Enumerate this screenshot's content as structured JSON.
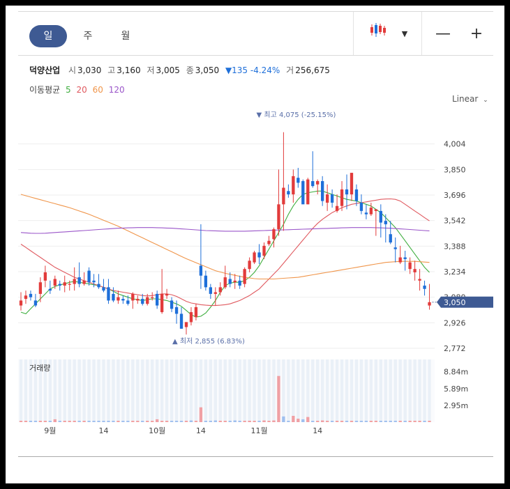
{
  "toolbar": {
    "tabs": [
      "일",
      "주",
      "월"
    ]
  },
  "summary": {
    "name": "덕양산업",
    "open_label": "시",
    "open": "3,030",
    "high_label": "고",
    "high": "3,160",
    "low_label": "저",
    "low": "3,005",
    "close_label": "종",
    "close": "3,050",
    "change": "▼135 -4.24%",
    "volume_label": "거",
    "volume": "256,675"
  },
  "ma_legend": {
    "title": "이동평균",
    "items": [
      {
        "label": "5",
        "color": "#3fae3f"
      },
      {
        "label": "20",
        "color": "#e0595f"
      },
      {
        "label": "60",
        "color": "#f0954a"
      },
      {
        "label": "120",
        "color": "#9a55c9"
      }
    ]
  },
  "scale": {
    "label": "Linear"
  },
  "colors": {
    "up": "#e23b3b",
    "down": "#1e6fd9",
    "axis_text": "#444",
    "grid": "#eeeeee",
    "badge": "#3e5a93"
  },
  "chart_data": {
    "type": "candlestick",
    "x_tick_labels": [
      {
        "index": 6,
        "label": "9월"
      },
      {
        "index": 17,
        "label": "14"
      },
      {
        "index": 28,
        "label": "10월"
      },
      {
        "index": 37,
        "label": "14"
      },
      {
        "index": 49,
        "label": "11월"
      },
      {
        "index": 61,
        "label": "14"
      }
    ],
    "y_ticks": [
      "4,004",
      "3,850",
      "3,696",
      "3,542",
      "3,388",
      "3,234",
      "3,080",
      "2,926",
      "2,772"
    ],
    "ylim": [
      2772,
      4158
    ],
    "max_annotation": {
      "index": 49,
      "text": "▼ 최고 4,075 (-25.15%)"
    },
    "min_annotation": {
      "index": 32,
      "text": "▲ 최저 2,855 (6.83%)"
    },
    "last_price_badge": "3,050",
    "volume_panel": {
      "title": "거래량",
      "y_ticks": [
        "8.84m",
        "5.89m",
        "2.95m"
      ],
      "ylim": [
        0,
        11000000
      ]
    },
    "ohlc": [
      [
        3030,
        3110,
        3000,
        3060
      ],
      [
        3070,
        3120,
        3040,
        3090
      ],
      [
        3100,
        3120,
        3060,
        3080
      ],
      [
        3060,
        3100,
        3020,
        3030
      ],
      [
        3100,
        3200,
        3050,
        3170
      ],
      [
        3180,
        3270,
        3140,
        3230
      ],
      [
        3130,
        3180,
        3100,
        3120
      ],
      [
        3150,
        3210,
        3130,
        3190
      ],
      [
        3160,
        3180,
        3120,
        3150
      ],
      [
        3150,
        3210,
        3110,
        3170
      ],
      [
        3160,
        3180,
        3120,
        3160
      ],
      [
        3160,
        3260,
        3120,
        3190
      ],
      [
        3200,
        3290,
        3140,
        3160
      ],
      [
        3160,
        3230,
        3150,
        3180
      ],
      [
        3240,
        3260,
        3150,
        3170
      ],
      [
        3180,
        3220,
        3140,
        3170
      ],
      [
        3160,
        3220,
        3130,
        3140
      ],
      [
        3140,
        3190,
        3110,
        3120
      ],
      [
        3140,
        3190,
        3040,
        3060
      ],
      [
        3100,
        3140,
        3050,
        3060
      ],
      [
        3060,
        3120,
        3040,
        3080
      ],
      [
        3070,
        3090,
        3040,
        3060
      ],
      [
        3060,
        3090,
        3030,
        3040
      ],
      [
        3060,
        3110,
        3010,
        3100
      ],
      [
        3060,
        3090,
        3040,
        3070
      ],
      [
        3070,
        3100,
        3030,
        3040
      ],
      [
        3040,
        3100,
        3030,
        3080
      ],
      [
        3080,
        3110,
        3060,
        3080
      ],
      [
        3100,
        3120,
        3010,
        3030
      ],
      [
        2990,
        3250,
        2980,
        3100
      ],
      [
        3090,
        3130,
        3070,
        3100
      ],
      [
        3060,
        3080,
        2990,
        3010
      ],
      [
        3020,
        3060,
        2920,
        2980
      ],
      [
        2980,
        3020,
        2890,
        2890
      ],
      [
        2900,
        2930,
        2855,
        2930
      ],
      [
        2930,
        3020,
        2910,
        2990
      ],
      [
        2960,
        3040,
        2940,
        3020
      ],
      [
        3270,
        3520,
        3130,
        3210
      ],
      [
        3210,
        3240,
        3120,
        3140
      ],
      [
        3140,
        3160,
        3070,
        3100
      ],
      [
        3100,
        3140,
        3030,
        3110
      ],
      [
        3110,
        3170,
        3090,
        3140
      ],
      [
        3140,
        3270,
        3130,
        3200
      ],
      [
        3190,
        3230,
        3140,
        3160
      ],
      [
        3170,
        3220,
        3130,
        3180
      ],
      [
        3180,
        3210,
        3130,
        3150
      ],
      [
        3160,
        3260,
        3140,
        3250
      ],
      [
        3250,
        3320,
        3230,
        3300
      ],
      [
        3290,
        3360,
        3280,
        3350
      ],
      [
        3350,
        3400,
        3280,
        3320
      ],
      [
        3330,
        3410,
        3310,
        3390
      ],
      [
        3400,
        3450,
        3390,
        3420
      ],
      [
        3430,
        3500,
        3380,
        3490
      ],
      [
        3490,
        3850,
        3450,
        3640
      ],
      [
        3640,
        4075,
        3480,
        3740
      ],
      [
        3720,
        3760,
        3680,
        3700
      ],
      [
        3700,
        3850,
        3650,
        3810
      ],
      [
        3800,
        3860,
        3740,
        3770
      ],
      [
        3780,
        3790,
        3660,
        3640
      ],
      [
        3640,
        3800,
        3640,
        3790
      ],
      [
        3780,
        3960,
        3740,
        3750
      ],
      [
        3760,
        3790,
        3700,
        3780
      ],
      [
        3780,
        3810,
        3630,
        3660
      ],
      [
        3650,
        3760,
        3600,
        3700
      ],
      [
        3700,
        3730,
        3620,
        3650
      ],
      [
        3600,
        3700,
        3590,
        3630
      ],
      [
        3630,
        3780,
        3600,
        3730
      ],
      [
        3730,
        3820,
        3610,
        3700
      ],
      [
        3700,
        3830,
        3660,
        3830
      ],
      [
        3730,
        3760,
        3630,
        3660
      ],
      [
        3650,
        3700,
        3580,
        3600
      ],
      [
        3590,
        3640,
        3550,
        3580
      ],
      [
        3580,
        3650,
        3570,
        3620
      ],
      [
        3600,
        3610,
        3450,
        3610
      ],
      [
        3600,
        3640,
        3440,
        3530
      ],
      [
        3540,
        3580,
        3410,
        3520
      ],
      [
        3460,
        3540,
        3400,
        3410
      ],
      [
        3380,
        3440,
        3290,
        3370
      ],
      [
        3290,
        3390,
        3280,
        3320
      ],
      [
        3320,
        3360,
        3240,
        3310
      ],
      [
        3250,
        3320,
        3220,
        3290
      ],
      [
        3230,
        3300,
        3180,
        3250
      ],
      [
        3180,
        3250,
        3120,
        3190
      ],
      [
        3150,
        3180,
        3090,
        3130
      ],
      [
        3030,
        3160,
        3005,
        3050
      ]
    ],
    "series": [
      {
        "name": "5",
        "color": "#3fae3f",
        "values": [
          2990,
          2980,
          3010,
          3040,
          3070,
          3100,
          3130,
          3145,
          3155,
          3160,
          3170,
          3175,
          3170,
          3165,
          3160,
          3155,
          3150,
          3140,
          3130,
          3115,
          3100,
          3090,
          3080,
          3070,
          3065,
          3060,
          3065,
          3070,
          3070,
          3065,
          3060,
          3050,
          3040,
          3025,
          3000,
          2975,
          2960,
          2965,
          2985,
          3020,
          3060,
          3110,
          3150,
          3165,
          3170,
          3170,
          3180,
          3200,
          3230,
          3270,
          3320,
          3370,
          3420,
          3470,
          3520,
          3580,
          3630,
          3670,
          3700,
          3710,
          3715,
          3720,
          3720,
          3710,
          3700,
          3690,
          3680,
          3670,
          3665,
          3660,
          3650,
          3640,
          3630,
          3610,
          3590,
          3560,
          3530,
          3500,
          3460,
          3420,
          3380,
          3340,
          3300,
          3260,
          3230
        ]
      },
      {
        "name": "20",
        "color": "#e0595f",
        "values": [
          3400,
          3380,
          3360,
          3340,
          3320,
          3300,
          3280,
          3260,
          3245,
          3230,
          3215,
          3200,
          3190,
          3180,
          3170,
          3160,
          3150,
          3140,
          3130,
          3120,
          3115,
          3110,
          3105,
          3100,
          3095,
          3090,
          3088,
          3090,
          3095,
          3100,
          3100,
          3095,
          3085,
          3070,
          3055,
          3045,
          3040,
          3035,
          3032,
          3030,
          3030,
          3032,
          3035,
          3040,
          3050,
          3060,
          3075,
          3090,
          3110,
          3130,
          3160,
          3190,
          3220,
          3250,
          3285,
          3320,
          3355,
          3390,
          3425,
          3460,
          3495,
          3525,
          3550,
          3570,
          3590,
          3605,
          3620,
          3630,
          3640,
          3645,
          3650,
          3655,
          3660,
          3665,
          3670,
          3672,
          3673,
          3670,
          3660,
          3640,
          3620,
          3600,
          3580,
          3560,
          3540
        ]
      },
      {
        "name": "60",
        "color": "#f0954a",
        "values": [
          3700,
          3692,
          3684,
          3676,
          3668,
          3660,
          3652,
          3644,
          3636,
          3628,
          3620,
          3610,
          3600,
          3590,
          3580,
          3568,
          3556,
          3544,
          3532,
          3520,
          3508,
          3494,
          3480,
          3466,
          3452,
          3438,
          3424,
          3410,
          3396,
          3382,
          3368,
          3354,
          3340,
          3326,
          3312,
          3300,
          3288,
          3276,
          3264,
          3252,
          3240,
          3232,
          3224,
          3218,
          3212,
          3206,
          3200,
          3196,
          3192,
          3190,
          3190,
          3190,
          3190,
          3192,
          3194,
          3196,
          3198,
          3200,
          3205,
          3210,
          3215,
          3220,
          3225,
          3230,
          3235,
          3240,
          3245,
          3250,
          3255,
          3260,
          3265,
          3270,
          3275,
          3280,
          3285,
          3290,
          3292,
          3294,
          3296,
          3296,
          3296,
          3296,
          3294,
          3292,
          3290
        ]
      },
      {
        "name": "120",
        "color": "#9a55c9",
        "values": [
          3470,
          3468,
          3466,
          3465,
          3465,
          3466,
          3468,
          3470,
          3472,
          3474,
          3476,
          3478,
          3480,
          3482,
          3484,
          3486,
          3488,
          3490,
          3492,
          3494,
          3496,
          3497,
          3498,
          3499,
          3500,
          3500,
          3500,
          3500,
          3499,
          3498,
          3497,
          3496,
          3494,
          3492,
          3490,
          3488,
          3486,
          3484,
          3482,
          3481,
          3480,
          3479,
          3478,
          3478,
          3478,
          3478,
          3478,
          3479,
          3480,
          3481,
          3482,
          3483,
          3484,
          3485,
          3486,
          3487,
          3488,
          3489,
          3490,
          3491,
          3492,
          3493,
          3494,
          3495,
          3496,
          3497,
          3498,
          3499,
          3500,
          3500,
          3500,
          3500,
          3500,
          3499,
          3498,
          3497,
          3496,
          3494,
          3492,
          3490,
          3488,
          3486,
          3484,
          3482,
          3480
        ]
      }
    ],
    "volume_bars": [
      {
        "index": 7,
        "value": 500000,
        "dir": "up"
      },
      {
        "index": 28,
        "value": 500000,
        "dir": "up"
      },
      {
        "index": 35,
        "value": 300000,
        "dir": "down"
      },
      {
        "index": 37,
        "value": 2600000,
        "dir": "up"
      },
      {
        "index": 40,
        "value": 300000,
        "dir": "down"
      },
      {
        "index": 44,
        "value": 300000,
        "dir": "down"
      },
      {
        "index": 47,
        "value": 250000,
        "dir": "up"
      },
      {
        "index": 50,
        "value": 300000,
        "dir": "up"
      },
      {
        "index": 52,
        "value": 300000,
        "dir": "up"
      },
      {
        "index": 53,
        "value": 8100000,
        "dir": "up"
      },
      {
        "index": 54,
        "value": 1000000,
        "dir": "down"
      },
      {
        "index": 56,
        "value": 1100000,
        "dir": "up"
      },
      {
        "index": 57,
        "value": 600000,
        "dir": "up"
      },
      {
        "index": 58,
        "value": 500000,
        "dir": "down"
      },
      {
        "index": 59,
        "value": 900000,
        "dir": "up"
      },
      {
        "index": 62,
        "value": 300000,
        "dir": "up"
      }
    ]
  }
}
